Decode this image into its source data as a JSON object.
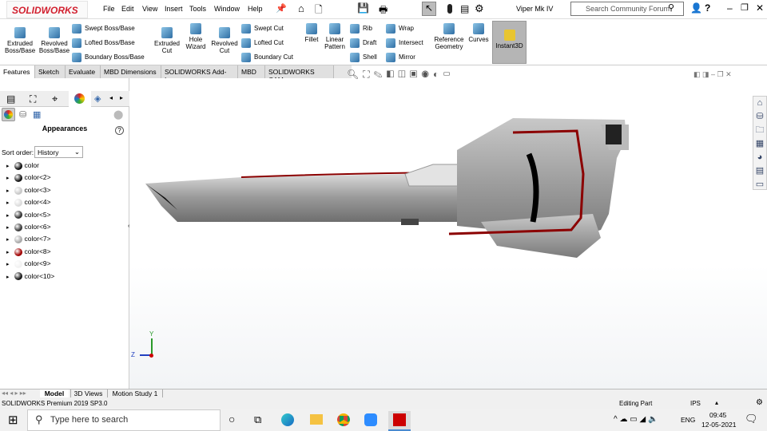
{
  "app": {
    "brand": "SOLIDWORKS",
    "doc_title": "Viper Mk IV",
    "search_placeholder": "Search Community Forum"
  },
  "menu": [
    "File",
    "Edit",
    "View",
    "Insert",
    "Tools",
    "Window",
    "Help"
  ],
  "ribbon": {
    "big": [
      {
        "label": "Extruded Boss/Base"
      },
      {
        "label": "Revolved Boss/Base"
      },
      {
        "label": "Extruded Cut"
      },
      {
        "label": "Hole Wizard"
      },
      {
        "label": "Revolved Cut"
      },
      {
        "label": "Fillet"
      },
      {
        "label": "Linear Pattern"
      },
      {
        "label": "Reference Geometry"
      },
      {
        "label": "Curves"
      },
      {
        "label": "Instant3D"
      }
    ],
    "small": [
      "Swept Boss/Base",
      "Lofted Boss/Base",
      "Boundary Boss/Base",
      "Swept Cut",
      "Lofted Cut",
      "Boundary Cut",
      "Rib",
      "Draft",
      "Shell",
      "Wrap",
      "Intersect",
      "Mirror"
    ]
  },
  "tabs": [
    "Features",
    "Sketch",
    "Evaluate",
    "MBD Dimensions",
    "SOLIDWORKS Add-Ins",
    "MBD",
    "SOLIDWORKS CAM"
  ],
  "panel": {
    "title": "Appearances",
    "sort_label": "Sort order:",
    "sort_value": "History",
    "items": [
      {
        "label": "color",
        "color": "#111111"
      },
      {
        "label": "color<2>",
        "color": "#151515"
      },
      {
        "label": "color<3>",
        "color": "#c8c8c8"
      },
      {
        "label": "color<4>",
        "color": "#dcdcdc"
      },
      {
        "label": "color<5>",
        "color": "#333333"
      },
      {
        "label": "color<6>",
        "color": "#3a3a3a"
      },
      {
        "label": "color<7>",
        "color": "#a9a9a9"
      },
      {
        "label": "color<8>",
        "color": "#a00000"
      },
      {
        "label": "color<9>",
        "color": "#f2f2f2"
      },
      {
        "label": "color<10>",
        "color": "#1a1a1a"
      }
    ]
  },
  "bottom_tabs": [
    "Model",
    "3D Views",
    "Motion Study 1"
  ],
  "status": {
    "version": "SOLIDWORKS Premium 2019 SP3.0",
    "mode": "Editing Part",
    "units": "IPS"
  },
  "taskbar": {
    "search": "Type here to search",
    "lang": "ENG",
    "time": "09:45",
    "date": "12-05-2021"
  },
  "triad": {
    "y": "Y",
    "z": "Z"
  }
}
